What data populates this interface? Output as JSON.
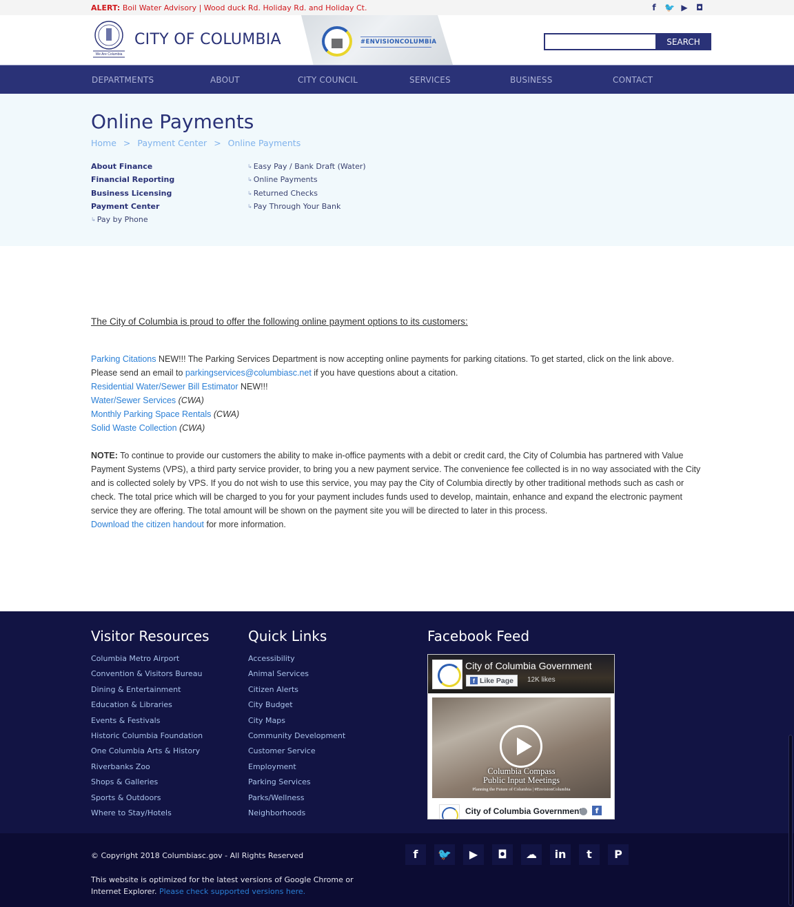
{
  "alert": {
    "label": "ALERT:",
    "text": "Boil Water Advisory | Wood duck Rd. Holiday Rd. and Holiday Ct."
  },
  "top_social": [
    {
      "icon": "facebook-icon",
      "glyph": "f"
    },
    {
      "icon": "twitter-icon",
      "glyph": "🐦"
    },
    {
      "icon": "youtube-icon",
      "glyph": "▶"
    },
    {
      "icon": "instagram-icon",
      "glyph": "◘"
    }
  ],
  "header": {
    "title": "CITY OF COLUMBIA",
    "seal_caption": "We Are Columbia",
    "envision_tag": "#ENVISIONCOLUMBIA",
    "search": {
      "value": "",
      "placeholder": "",
      "button_label": "SEARCH"
    }
  },
  "nav": {
    "items": [
      "DEPARTMENTS",
      "ABOUT",
      "CITY COUNCIL",
      "SERVICES",
      "BUSINESS",
      "CONTACT"
    ]
  },
  "page": {
    "title": "Online Payments",
    "breadcrumb": [
      "Home",
      "Payment Center",
      "Online Payments"
    ],
    "breadcrumb_separator": ">"
  },
  "subnav": {
    "left": [
      {
        "label": "About Finance",
        "bold": true
      },
      {
        "label": "Financial Reporting",
        "bold": true
      },
      {
        "label": "Business Licensing",
        "bold": true
      },
      {
        "label": "Payment Center",
        "bold": true
      },
      {
        "label": "Pay by Phone",
        "bold": false
      }
    ],
    "right": [
      {
        "label": "Easy Pay / Bank Draft (Water)"
      },
      {
        "label": "Online Payments"
      },
      {
        "label": "Returned Checks"
      },
      {
        "label": "Pay Through Your Bank"
      }
    ],
    "child_arrow": "↳"
  },
  "main": {
    "intro": "The City of Columbia is proud to offer the following online payment options to its customers:",
    "parking_link": "Parking Citations",
    "parking_text": " NEW!!! The Parking Services Department is now accepting online payments for parking citations. To get started, click on the link above.",
    "email_prefix": "Please send an email to ",
    "email_link": "parkingservices@columbiasc.net",
    "email_suffix": " if you have questions about a citation.",
    "estimator_link": "Residential Water/Sewer Bill Estimator",
    "estimator_suffix": " NEW!!!",
    "services": [
      {
        "link": "Water/Sewer Services",
        "note": "(CWA)"
      },
      {
        "link": "Monthly Parking Space Rentals",
        "note": "(CWA)"
      },
      {
        "link": "Solid Waste Collection",
        "note": "(CWA)"
      }
    ],
    "note_label": "NOTE:",
    "note_text": " To continue to provide our customers the ability to make in-office payments with a debit or credit card, the City of Columbia has partnered with Value Payment Systems (VPS), a third party service provider, to bring you a new payment service. The convenience fee collected is in no way associated with the City and is collected solely by VPS. If you do not wish to use this service, you may pay the City of Columbia directly by other traditional methods such as cash or check. The total price which will be charged to you for your payment includes funds used to develop, maintain, enhance and expand the electronic payment service they are offering. The total amount will be shown on the payment site you will be directed to later in this process.",
    "handout_link": "Download the citizen handout",
    "handout_suffix": " for more information."
  },
  "footer": {
    "visitor_title": "Visitor Resources",
    "visitor_links": [
      "Columbia Metro Airport",
      "Convention & Visitors Bureau",
      "Dining & Entertainment",
      "Education & Libraries",
      "Events & Festivals",
      "Historic Columbia Foundation",
      "One Columbia Arts & History",
      "Riverbanks Zoo",
      "Shops & Galleries",
      "Sports & Outdoors",
      "Where to Stay/Hotels"
    ],
    "quick_title": "Quick Links",
    "quick_links": [
      "Accessibility",
      "Animal Services",
      "Citizen Alerts",
      "City Budget",
      "City Maps",
      "Community Development",
      "Customer Service",
      "Employment",
      "Parking Services",
      "Parks/Wellness",
      "Neighborhoods"
    ],
    "facebook_title": "Facebook Feed",
    "facebook": {
      "page_name": "City of Columbia Government",
      "like_label": "Like Page",
      "likes": "12K likes",
      "video_title_1": "Columbia Compass",
      "video_title_2": "Public Input Meetings",
      "video_subtitle": "Planning the Future of Columbia | #EnvisionColumbia",
      "post_author": "City of Columbia Government"
    }
  },
  "bottom": {
    "copyright": "© Copyright 2018 Columbiasc.gov - All Rights Reserved",
    "optimized_text": "This website is optimized for the latest versions of Google Chrome or Internet Explorer. ",
    "optimized_link": "Please check supported versions here.",
    "social": [
      {
        "icon": "facebook-icon",
        "glyph": "f"
      },
      {
        "icon": "twitter-icon",
        "glyph": "🐦"
      },
      {
        "icon": "youtube-icon",
        "glyph": "▶"
      },
      {
        "icon": "instagram-icon",
        "glyph": "◘"
      },
      {
        "icon": "soundcloud-icon",
        "glyph": "☁"
      },
      {
        "icon": "linkedin-icon",
        "glyph": "in"
      },
      {
        "icon": "tumblr-icon",
        "glyph": "t"
      },
      {
        "icon": "pinterest-icon",
        "glyph": "P"
      }
    ]
  },
  "colors": {
    "brand_navy": "#2a3277",
    "alert_red": "#d0181c",
    "link_blue": "#2a7fd6",
    "footer_bg": "#121444",
    "bottom_bg": "#0c0c33",
    "subheader_bg": "#f1f9fc"
  }
}
